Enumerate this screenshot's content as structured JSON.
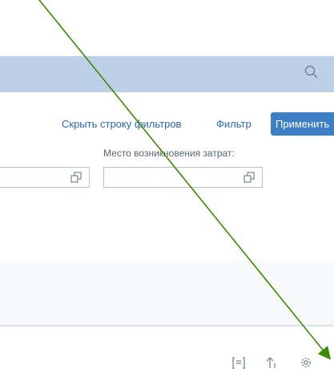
{
  "filter_bar": {
    "hide_filter_bar_label": "Скрыть строку фильтров",
    "filter_label": "Фильтр",
    "apply_label": "Применить"
  },
  "fields": {
    "cost_center_label": "Место возникновения затрат:",
    "cost_center_value": "",
    "prev_field_value": ""
  },
  "icons": {
    "search": "search-icon",
    "value_help": "value-help-icon",
    "sort": "sort-icon",
    "settings": "gear-icon",
    "list": "list-icon"
  },
  "colors": {
    "header_bar": "#bcd1e7",
    "accent": "#3d7fc5",
    "link": "#2a6ab2",
    "annotation_arrow": "#3b8a00"
  }
}
